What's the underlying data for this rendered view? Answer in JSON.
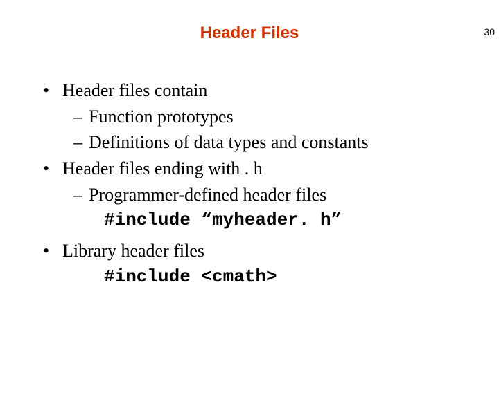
{
  "page_number": "30",
  "title": "Header Files",
  "content": {
    "b1": {
      "text": "Header files contain",
      "s1": "Function prototypes",
      "s2": "Definitions of data types and constants"
    },
    "b2": {
      "text": "Header files ending with . h",
      "s1": "Programmer-defined header files",
      "code": "#include “myheader. h”"
    },
    "b3": {
      "text": "Library header files",
      "code": "#include <cmath>"
    }
  }
}
